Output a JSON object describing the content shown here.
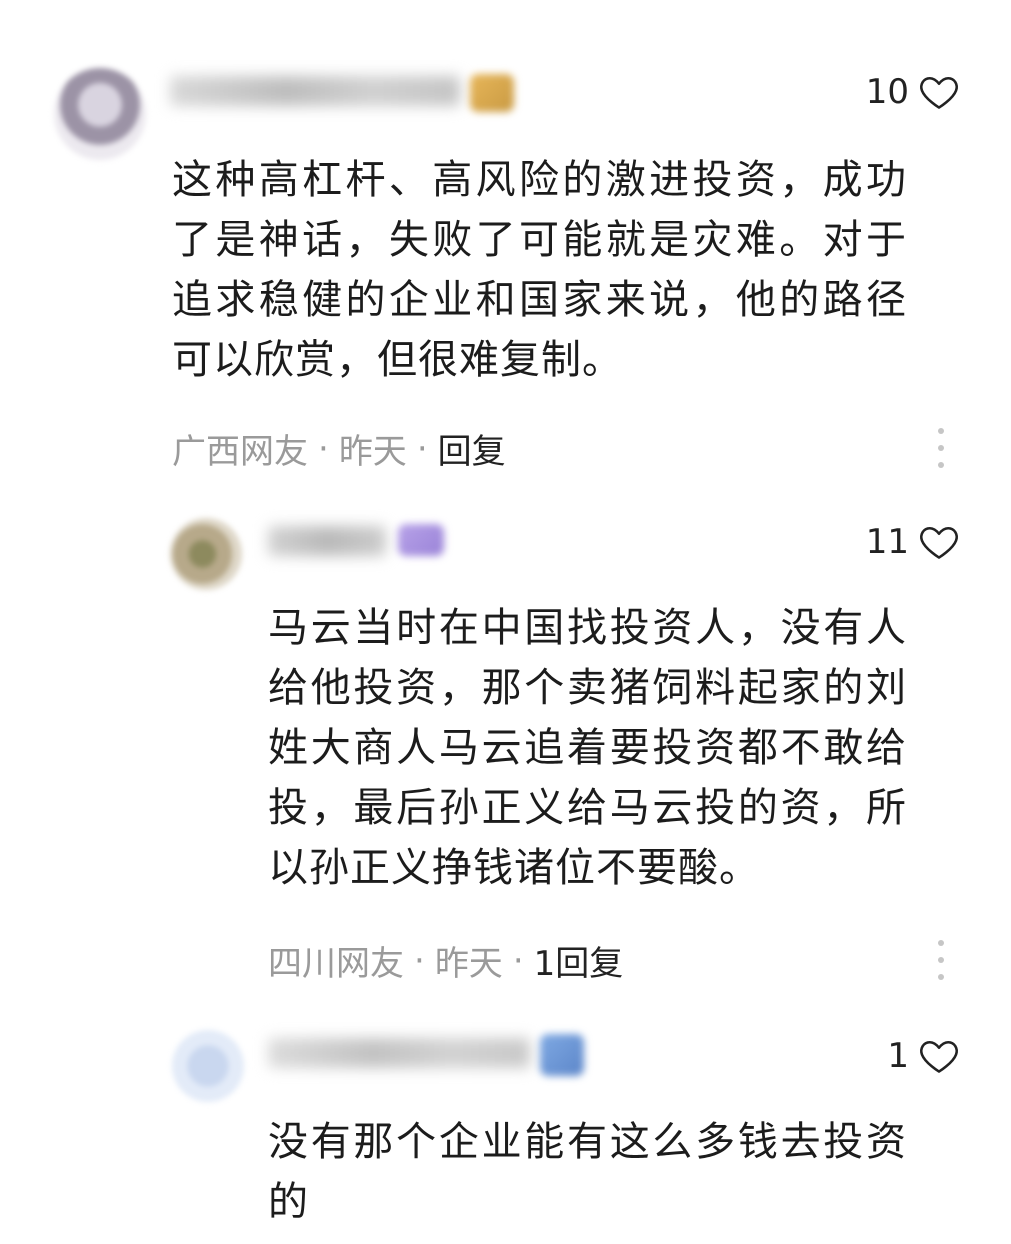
{
  "comments": [
    {
      "likes": "10",
      "text": "这种高杠杆、高风险的激进投资，成功了是神话，失败了可能就是灾难。对于追求稳健的企业和国家来说，他的路径可以欣赏，但很难复制。",
      "location": "广西网友",
      "sep1": "·",
      "time": "昨天",
      "sep2": "·",
      "reply": "回复"
    },
    {
      "likes": "11",
      "text": "马云当时在中国找投资人，没有人给他投资，那个卖猪饲料起家的刘姓大商人马云追着要投资都不敢给投，最后孙正义给马云投的资，所以孙正义挣钱诸位不要酸。",
      "location": "四川网友",
      "sep1": "·",
      "time": "昨天",
      "sep2": "·",
      "reply": "1回复"
    },
    {
      "likes": "1",
      "text": "没有那个企业能有这么多钱去投资的"
    }
  ],
  "icons": {
    "like": "heart-outline-icon",
    "more": "vertical-ellipsis-icon"
  },
  "colors": {
    "meta_text": "#9a9a9a",
    "body_text": "#1c1c1c",
    "more_dots": "#c6c6c6"
  }
}
